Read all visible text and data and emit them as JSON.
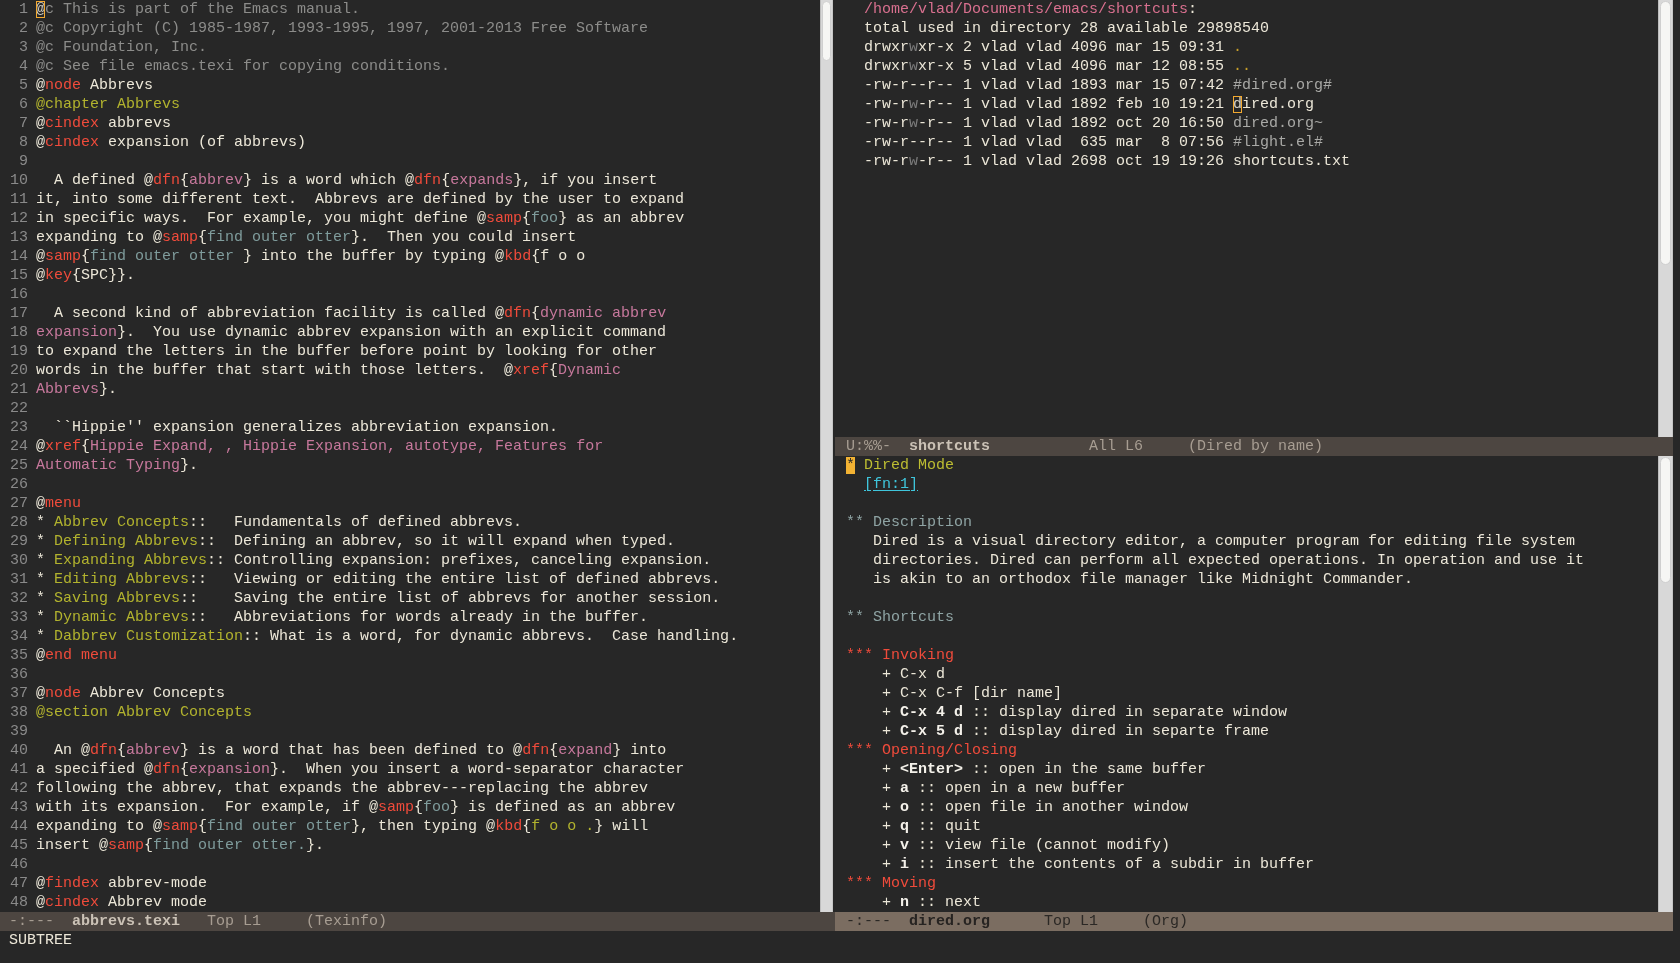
{
  "windows": [
    {
      "kind": "texinfo",
      "selected": false,
      "lines": [
        {
          "number": "1",
          "segments": [
            {
              "text": "@",
              "kind": "cursor"
            },
            {
              "text": "c This is part of the Emacs manual.",
              "kind": "comment"
            }
          ]
        },
        {
          "number": "2",
          "segments": [
            {
              "text": "@c Copyright (C) 1985-1987, 1993-1995, 1997, 2001-2013 Free Software",
              "kind": "comment"
            }
          ]
        },
        {
          "number": "3",
          "segments": [
            {
              "text": "@c Foundation, Inc.",
              "kind": "comment"
            }
          ]
        },
        {
          "number": "4",
          "segments": [
            {
              "text": "@c See file emacs.texi for copying conditions.",
              "kind": "comment"
            }
          ]
        },
        {
          "number": "5",
          "segments": [
            {
              "text": "@",
              "kind": "text"
            },
            {
              "text": "node",
              "kind": "keyword"
            },
            {
              "text": " Abbrevs",
              "kind": "text"
            }
          ]
        },
        {
          "number": "6",
          "segments": [
            {
              "text": "@chapter Abbrevs",
              "kind": "heading"
            }
          ]
        },
        {
          "number": "7",
          "segments": [
            {
              "text": "@",
              "kind": "text"
            },
            {
              "text": "cindex",
              "kind": "keyword"
            },
            {
              "text": " abbrevs",
              "kind": "text"
            }
          ]
        },
        {
          "number": "8",
          "segments": [
            {
              "text": "@",
              "kind": "text"
            },
            {
              "text": "cindex",
              "kind": "keyword"
            },
            {
              "text": " expansion (of abbrevs)",
              "kind": "text"
            }
          ]
        },
        {
          "number": "9"
        },
        {
          "number": "10",
          "segments": [
            {
              "text": "  A defined @",
              "kind": "text"
            },
            {
              "text": "dfn",
              "kind": "keyword"
            },
            {
              "text": "{",
              "kind": "text"
            },
            {
              "text": "abbrev",
              "kind": "term"
            },
            {
              "text": "} is a word which @",
              "kind": "text"
            },
            {
              "text": "dfn",
              "kind": "keyword"
            },
            {
              "text": "{",
              "kind": "text"
            },
            {
              "text": "expands",
              "kind": "term"
            },
            {
              "text": "}, if you insert",
              "kind": "text"
            }
          ]
        },
        {
          "number": "11",
          "segments": [
            {
              "text": "it, into some different text.  Abbrevs are defined by the user to expand",
              "kind": "text"
            }
          ]
        },
        {
          "number": "12",
          "segments": [
            {
              "text": "in specific ways.  For example, you might define @",
              "kind": "text"
            },
            {
              "text": "samp",
              "kind": "keyword"
            },
            {
              "text": "{",
              "kind": "text"
            },
            {
              "text": "foo",
              "kind": "sample"
            },
            {
              "text": "} as an abbrev",
              "kind": "text"
            }
          ]
        },
        {
          "number": "13",
          "segments": [
            {
              "text": "expanding to @",
              "kind": "text"
            },
            {
              "text": "samp",
              "kind": "keyword"
            },
            {
              "text": "{",
              "kind": "text"
            },
            {
              "text": "find outer otter",
              "kind": "sample"
            },
            {
              "text": "}.  Then you could insert",
              "kind": "text"
            }
          ]
        },
        {
          "number": "14",
          "segments": [
            {
              "text": "@",
              "kind": "text"
            },
            {
              "text": "samp",
              "kind": "keyword"
            },
            {
              "text": "{",
              "kind": "text"
            },
            {
              "text": "find outer otter ",
              "kind": "sample"
            },
            {
              "text": "} into the buffer by typing @",
              "kind": "text"
            },
            {
              "text": "kbd",
              "kind": "keyword"
            },
            {
              "text": "{f o o",
              "kind": "text"
            }
          ]
        },
        {
          "number": "15",
          "segments": [
            {
              "text": "@",
              "kind": "text"
            },
            {
              "text": "key",
              "kind": "keyword"
            },
            {
              "text": "{SPC}}.",
              "kind": "text"
            }
          ]
        },
        {
          "number": "16"
        },
        {
          "number": "17",
          "segments": [
            {
              "text": "  A second kind of abbreviation facility is called @",
              "kind": "text"
            },
            {
              "text": "dfn",
              "kind": "keyword"
            },
            {
              "text": "{",
              "kind": "text"
            },
            {
              "text": "dynamic abbrev",
              "kind": "term"
            }
          ]
        },
        {
          "number": "18",
          "segments": [
            {
              "text": "expansion",
              "kind": "term"
            },
            {
              "text": "}.  You use dynamic abbrev expansion with an explicit command",
              "kind": "text"
            }
          ]
        },
        {
          "number": "19",
          "segments": [
            {
              "text": "to expand the letters in the buffer before point by looking for other",
              "kind": "text"
            }
          ]
        },
        {
          "number": "20",
          "segments": [
            {
              "text": "words in the buffer that start with those letters.  @",
              "kind": "text"
            },
            {
              "text": "xref",
              "kind": "keyword"
            },
            {
              "text": "{",
              "kind": "text"
            },
            {
              "text": "Dynamic",
              "kind": "term"
            }
          ]
        },
        {
          "number": "21",
          "segments": [
            {
              "text": "Abbrevs",
              "kind": "term"
            },
            {
              "text": "}.",
              "kind": "text"
            }
          ]
        },
        {
          "number": "22"
        },
        {
          "number": "23",
          "segments": [
            {
              "text": "  ``Hippie'' expansion generalizes abbreviation expansion.",
              "kind": "text"
            }
          ]
        },
        {
          "number": "24",
          "segments": [
            {
              "text": "@",
              "kind": "text"
            },
            {
              "text": "xref",
              "kind": "keyword"
            },
            {
              "text": "{",
              "kind": "text"
            },
            {
              "text": "Hippie Expand, , Hippie Expansion, autotype, Features for",
              "kind": "term"
            }
          ]
        },
        {
          "number": "25",
          "segments": [
            {
              "text": "Automatic Typing",
              "kind": "term"
            },
            {
              "text": "}.",
              "kind": "text"
            }
          ]
        },
        {
          "number": "26"
        },
        {
          "number": "27",
          "segments": [
            {
              "text": "@",
              "kind": "text"
            },
            {
              "text": "menu",
              "kind": "keyword"
            }
          ]
        },
        {
          "number": "28",
          "segments": [
            {
              "text": "* ",
              "kind": "text"
            },
            {
              "text": "Abbrev Concepts",
              "kind": "heading"
            },
            {
              "text": "::   Fundamentals of defined abbrevs.",
              "kind": "text"
            }
          ]
        },
        {
          "number": "29",
          "segments": [
            {
              "text": "* ",
              "kind": "text"
            },
            {
              "text": "Defining Abbrevs",
              "kind": "heading"
            },
            {
              "text": "::  Defining an abbrev, so it will expand when typed.",
              "kind": "text"
            }
          ]
        },
        {
          "number": "30",
          "segments": [
            {
              "text": "* ",
              "kind": "text"
            },
            {
              "text": "Expanding Abbrevs",
              "kind": "heading"
            },
            {
              "text": ":: Controlling expansion: prefixes, canceling expansion.",
              "kind": "text"
            }
          ]
        },
        {
          "number": "31",
          "segments": [
            {
              "text": "* ",
              "kind": "text"
            },
            {
              "text": "Editing Abbrevs",
              "kind": "heading"
            },
            {
              "text": "::   Viewing or editing the entire list of defined abbrevs.",
              "kind": "text"
            }
          ]
        },
        {
          "number": "32",
          "segments": [
            {
              "text": "* ",
              "kind": "text"
            },
            {
              "text": "Saving Abbrevs",
              "kind": "heading"
            },
            {
              "text": "::    Saving the entire list of abbrevs for another session.",
              "kind": "text"
            }
          ]
        },
        {
          "number": "33",
          "segments": [
            {
              "text": "* ",
              "kind": "text"
            },
            {
              "text": "Dynamic Abbrevs",
              "kind": "heading"
            },
            {
              "text": "::   Abbreviations for words already in the buffer.",
              "kind": "text"
            }
          ]
        },
        {
          "number": "34",
          "segments": [
            {
              "text": "* ",
              "kind": "text"
            },
            {
              "text": "Dabbrev Customization",
              "kind": "heading"
            },
            {
              "text": ":: What is a word, for dynamic abbrevs.  Case handling.",
              "kind": "text"
            }
          ]
        },
        {
          "number": "35",
          "segments": [
            {
              "text": "@",
              "kind": "text"
            },
            {
              "text": "end menu",
              "kind": "keyword"
            }
          ]
        },
        {
          "number": "36"
        },
        {
          "number": "37",
          "segments": [
            {
              "text": "@",
              "kind": "text"
            },
            {
              "text": "node",
              "kind": "keyword"
            },
            {
              "text": " Abbrev Concepts",
              "kind": "text"
            }
          ]
        },
        {
          "number": "38",
          "segments": [
            {
              "text": "@section Abbrev Concepts",
              "kind": "heading"
            }
          ]
        },
        {
          "number": "39"
        },
        {
          "number": "40",
          "segments": [
            {
              "text": "  An @",
              "kind": "text"
            },
            {
              "text": "dfn",
              "kind": "keyword"
            },
            {
              "text": "{",
              "kind": "text"
            },
            {
              "text": "abbrev",
              "kind": "term"
            },
            {
              "text": "} is a word that has been defined to @",
              "kind": "text"
            },
            {
              "text": "dfn",
              "kind": "keyword"
            },
            {
              "text": "{",
              "kind": "text"
            },
            {
              "text": "expand",
              "kind": "term"
            },
            {
              "text": "} into",
              "kind": "text"
            }
          ]
        },
        {
          "number": "41",
          "segments": [
            {
              "text": "a specified @",
              "kind": "text"
            },
            {
              "text": "dfn",
              "kind": "keyword"
            },
            {
              "text": "{",
              "kind": "text"
            },
            {
              "text": "expansion",
              "kind": "term"
            },
            {
              "text": "}.  When you insert a word-separator character",
              "kind": "text"
            }
          ]
        },
        {
          "number": "42",
          "segments": [
            {
              "text": "following the abbrev, that expands the abbrev---replacing the abbrev",
              "kind": "text"
            }
          ]
        },
        {
          "number": "43",
          "segments": [
            {
              "text": "with its expansion.  For example, if @",
              "kind": "text"
            },
            {
              "text": "samp",
              "kind": "keyword"
            },
            {
              "text": "{",
              "kind": "text"
            },
            {
              "text": "foo",
              "kind": "sample"
            },
            {
              "text": "} is defined as an abbrev",
              "kind": "text"
            }
          ]
        },
        {
          "number": "44",
          "segments": [
            {
              "text": "expanding to @",
              "kind": "text"
            },
            {
              "text": "samp",
              "kind": "keyword"
            },
            {
              "text": "{",
              "kind": "text"
            },
            {
              "text": "find outer otter",
              "kind": "sample"
            },
            {
              "text": "}, then typing @",
              "kind": "text"
            },
            {
              "text": "kbd",
              "kind": "keyword"
            },
            {
              "text": "{",
              "kind": "text"
            },
            {
              "text": "f o o .",
              "kind": "key"
            },
            {
              "text": "} will",
              "kind": "text"
            }
          ]
        },
        {
          "number": "45",
          "segments": [
            {
              "text": "insert @",
              "kind": "text"
            },
            {
              "text": "samp",
              "kind": "keyword"
            },
            {
              "text": "{",
              "kind": "text"
            },
            {
              "text": "find outer otter.",
              "kind": "sample"
            },
            {
              "text": "}.",
              "kind": "text"
            }
          ]
        },
        {
          "number": "46"
        },
        {
          "number": "47",
          "segments": [
            {
              "text": "@",
              "kind": "text"
            },
            {
              "text": "findex",
              "kind": "keyword"
            },
            {
              "text": " abbrev-mode",
              "kind": "text"
            }
          ]
        },
        {
          "number": "48",
          "segments": [
            {
              "text": "@",
              "kind": "text"
            },
            {
              "text": "cindex",
              "kind": "keyword"
            },
            {
              "text": " Abbrev mode",
              "kind": "text"
            }
          ]
        }
      ],
      "mode_line": {
        "status": "-:---",
        "buffer": "abbrevs.texi",
        "position": "Top L1",
        "mode": "(Texinfo)"
      }
    },
    {
      "kind": "dired",
      "selected": false,
      "lines": [
        {
          "segments": [
            {
              "text": "  /home/vlad/Documents/emacs/shortcuts",
              "kind": "path"
            },
            {
              "text": ":",
              "kind": "text"
            }
          ]
        },
        {
          "segments": [
            {
              "text": "  total used in directory 28 available 29898540",
              "kind": "text"
            }
          ]
        },
        {
          "segments": [
            {
              "text": "  drwxr",
              "kind": "text"
            },
            {
              "text": "w",
              "kind": "dim"
            },
            {
              "text": "xr-x 2 vlad vlad 4096 mar 15 09:31 ",
              "kind": "text"
            },
            {
              "text": ".",
              "kind": "dir"
            }
          ]
        },
        {
          "segments": [
            {
              "text": "  drwxr",
              "kind": "text"
            },
            {
              "text": "w",
              "kind": "dim"
            },
            {
              "text": "xr-x 5 vlad vlad 4096 mar 12 08:55 ",
              "kind": "text"
            },
            {
              "text": "..",
              "kind": "dir"
            }
          ]
        },
        {
          "segments": [
            {
              "text": "  -rw-r--r-- 1 vlad vlad 1893 mar 15 07:42 ",
              "kind": "text"
            },
            {
              "text": "#dired.org#",
              "kind": "backup"
            }
          ]
        },
        {
          "segments": [
            {
              "text": "  -rw-r",
              "kind": "text"
            },
            {
              "text": "w",
              "kind": "dim"
            },
            {
              "text": "-r-- 1 vlad vlad 1892 feb 10 19:21 ",
              "kind": "text"
            },
            {
              "text": "d",
              "kind": "cursor"
            },
            {
              "text": "ired.org",
              "kind": "text"
            }
          ]
        },
        {
          "segments": [
            {
              "text": "  -rw-r",
              "kind": "text"
            },
            {
              "text": "w",
              "kind": "dim"
            },
            {
              "text": "-r-- 1 vlad vlad 1892 oct 20 16:50 ",
              "kind": "text"
            },
            {
              "text": "dired.org~",
              "kind": "backup"
            }
          ]
        },
        {
          "segments": [
            {
              "text": "  -rw-r--r-- 1 vlad vlad  635 mar  8 07:56 ",
              "kind": "text"
            },
            {
              "text": "#light.el#",
              "kind": "backup"
            }
          ]
        },
        {
          "segments": [
            {
              "text": "  -rw-r",
              "kind": "text"
            },
            {
              "text": "w",
              "kind": "dim"
            },
            {
              "text": "-r-- 1 vlad vlad 2698 oct 19 19:26 shortcuts.txt",
              "kind": "text"
            }
          ]
        }
      ],
      "mode_line": {
        "status": "U:%%-",
        "buffer": "shortcuts",
        "position": "All L6",
        "mode": "(Dired by name)"
      }
    },
    {
      "kind": "org",
      "selected": true,
      "blocks": [
        {
          "lines": [
            {
              "segments": [
                {
                  "text": "*",
                  "kind": "cursor"
                },
                {
                  "text": " Dired Mode",
                  "kind": "heading1"
                }
              ]
            },
            {
              "segments": [
                {
                  "text": "  [fn:1]",
                  "kind": "link"
                }
              ]
            }
          ]
        },
        {
          "lines": [
            {
              "segments": [
                {
                  "text": "** Description",
                  "kind": "heading2"
                }
              ]
            },
            {
              "segments": [
                {
                  "text": "   Dired is a visual directory editor, a computer program for editing file system",
                  "kind": "text"
                }
              ]
            },
            {
              "segments": [
                {
                  "text": "   directories. Dired can perform all expected operations. In operation and use it",
                  "kind": "text"
                }
              ]
            },
            {
              "segments": [
                {
                  "text": "   is akin to an orthodox file manager like Midnight Commander.",
                  "kind": "text"
                }
              ]
            }
          ]
        },
        {
          "lines": [
            {
              "segments": [
                {
                  "text": "** Shortcuts",
                  "kind": "heading2"
                }
              ]
            }
          ]
        },
        {
          "lines": [
            {
              "segments": [
                {
                  "text": "*** Invoking",
                  "kind": "heading3"
                }
              ]
            },
            {
              "segments": [
                {
                  "text": "    + C-x d",
                  "kind": "text"
                }
              ]
            },
            {
              "segments": [
                {
                  "text": "    + C-x C-f [dir name]",
                  "kind": "text"
                }
              ]
            },
            {
              "segments": [
                {
                  "text": "    + ",
                  "kind": "text"
                },
                {
                  "text": "C-x 4 d",
                  "kind": "bold"
                },
                {
                  "text": " :: display dired in separate window",
                  "kind": "text"
                }
              ]
            },
            {
              "segments": [
                {
                  "text": "    + ",
                  "kind": "text"
                },
                {
                  "text": "C-x 5 d",
                  "kind": "bold"
                },
                {
                  "text": " :: display dired in separte frame",
                  "kind": "text"
                }
              ]
            },
            {
              "segments": [
                {
                  "text": "*** Opening/Closing",
                  "kind": "heading3"
                }
              ]
            },
            {
              "segments": [
                {
                  "text": "    + ",
                  "kind": "text"
                },
                {
                  "text": "<Enter>",
                  "kind": "bold"
                },
                {
                  "text": " :: open in the same buffer",
                  "kind": "text"
                }
              ]
            },
            {
              "segments": [
                {
                  "text": "    + ",
                  "kind": "text"
                },
                {
                  "text": "a",
                  "kind": "bold"
                },
                {
                  "text": " :: open in a new buffer",
                  "kind": "text"
                }
              ]
            },
            {
              "segments": [
                {
                  "text": "    + ",
                  "kind": "text"
                },
                {
                  "text": "o",
                  "kind": "bold"
                },
                {
                  "text": " :: open file in another window",
                  "kind": "text"
                }
              ]
            },
            {
              "segments": [
                {
                  "text": "    + ",
                  "kind": "text"
                },
                {
                  "text": "q",
                  "kind": "bold"
                },
                {
                  "text": " :: quit",
                  "kind": "text"
                }
              ]
            },
            {
              "segments": [
                {
                  "text": "    + ",
                  "kind": "text"
                },
                {
                  "text": "v",
                  "kind": "bold"
                },
                {
                  "text": " :: view file (cannot modify)",
                  "kind": "text"
                }
              ]
            },
            {
              "segments": [
                {
                  "text": "    + ",
                  "kind": "text"
                },
                {
                  "text": "i",
                  "kind": "bold"
                },
                {
                  "text": " :: insert the contents of a subdir in buffer",
                  "kind": "text"
                }
              ]
            },
            {
              "segments": [
                {
                  "text": "*** Moving",
                  "kind": "heading3"
                }
              ]
            },
            {
              "segments": [
                {
                  "text": "    + ",
                  "kind": "text"
                },
                {
                  "text": "n",
                  "kind": "bold"
                },
                {
                  "text": " :: next",
                  "kind": "text"
                }
              ]
            }
          ]
        }
      ],
      "mode_line": {
        "status": "-:---",
        "buffer": "dired.org",
        "position": "Top L1",
        "mode": "(Org)"
      }
    }
  ],
  "echo_area": "SUBTREE"
}
